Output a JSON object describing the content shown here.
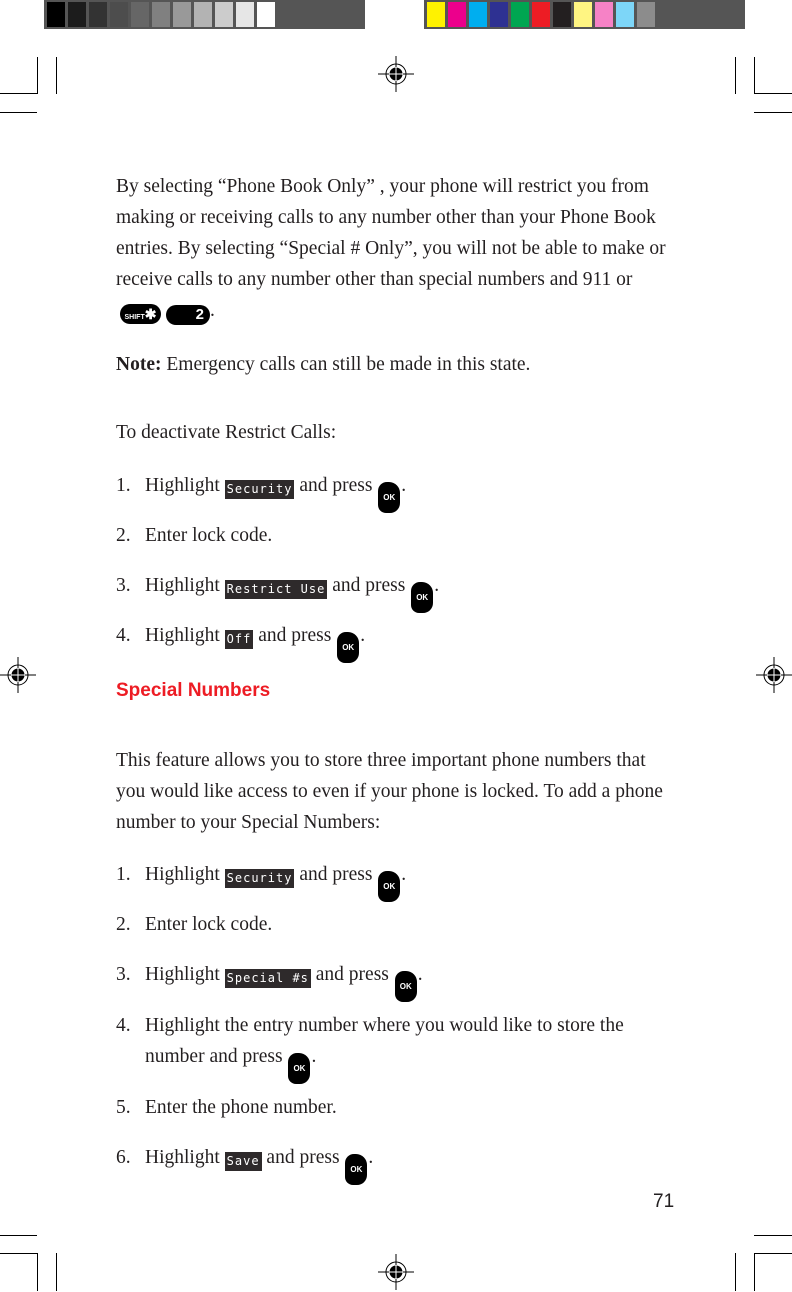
{
  "print_marks": {
    "gray_swatches": [
      "#000000",
      "#1c1c1c",
      "#333333",
      "#4d4d4d",
      "#666666",
      "#808080",
      "#999999",
      "#b3b3b3",
      "#cccccc",
      "#e6e6e6",
      "#ffffff"
    ],
    "color_swatches": [
      "#fff200",
      "#ec008c",
      "#00aeef",
      "#2e3192",
      "#00a651",
      "#ed1c24",
      "#231f20",
      "#fff582",
      "#f682c6",
      "#7dd6f8",
      "#8c8c8c"
    ]
  },
  "intro": {
    "paragraph": "By selecting “Phone Book Only” , your phone will restrict you from making or receiving calls to any number other than your Phone Book entries. By selecting “Special # Only”,  you will not be able to make or receive calls to any number other than special numbers and 911 or",
    "keys": {
      "shift_label": "SHIFT",
      "shift_symbol": "✱",
      "two_label": "2"
    },
    "period": "."
  },
  "note": {
    "label": "Note:",
    "text": " Emergency calls can still be made in this state."
  },
  "deactivate": {
    "intro": "To deactivate Restrict Calls:",
    "steps": [
      {
        "num": "1.",
        "pre": "Highlight ",
        "lcd": "Security",
        "post": " and press ",
        "key": "OK",
        "end": "."
      },
      {
        "num": "2.",
        "text": "Enter lock code."
      },
      {
        "num": "3.",
        "pre": "Highlight ",
        "lcd": "Restrict Use",
        "post": " and press ",
        "key": "OK",
        "end": "."
      },
      {
        "num": "4.",
        "pre": "Highlight ",
        "lcd": "Off",
        "post": " and press ",
        "key": "OK",
        "end": "."
      }
    ]
  },
  "special": {
    "heading": "Special Numbers",
    "heading_color": "#ed1c24",
    "intro": "This feature allows you to store three important phone numbers that you would like access to even if your phone is locked. To add a phone number to your Special Numbers:",
    "steps": [
      {
        "num": "1.",
        "pre": "Highlight ",
        "lcd": "Security",
        "post": " and press ",
        "key": "OK",
        "end": "."
      },
      {
        "num": "2.",
        "text": "Enter lock code."
      },
      {
        "num": "3.",
        "pre": "Highlight ",
        "lcd": "Special #s",
        "post": " and press ",
        "key": "OK",
        "end": "."
      },
      {
        "num": "4.",
        "text": "Highlight the entry number where you would like to store the number and press ",
        "key": "OK",
        "end": "."
      },
      {
        "num": "5.",
        "text": "Enter the phone number."
      },
      {
        "num": "6.",
        "pre": "Highlight ",
        "lcd": "Save",
        "post": " and press ",
        "key": "OK",
        "end": "."
      }
    ]
  },
  "page_number": "71"
}
